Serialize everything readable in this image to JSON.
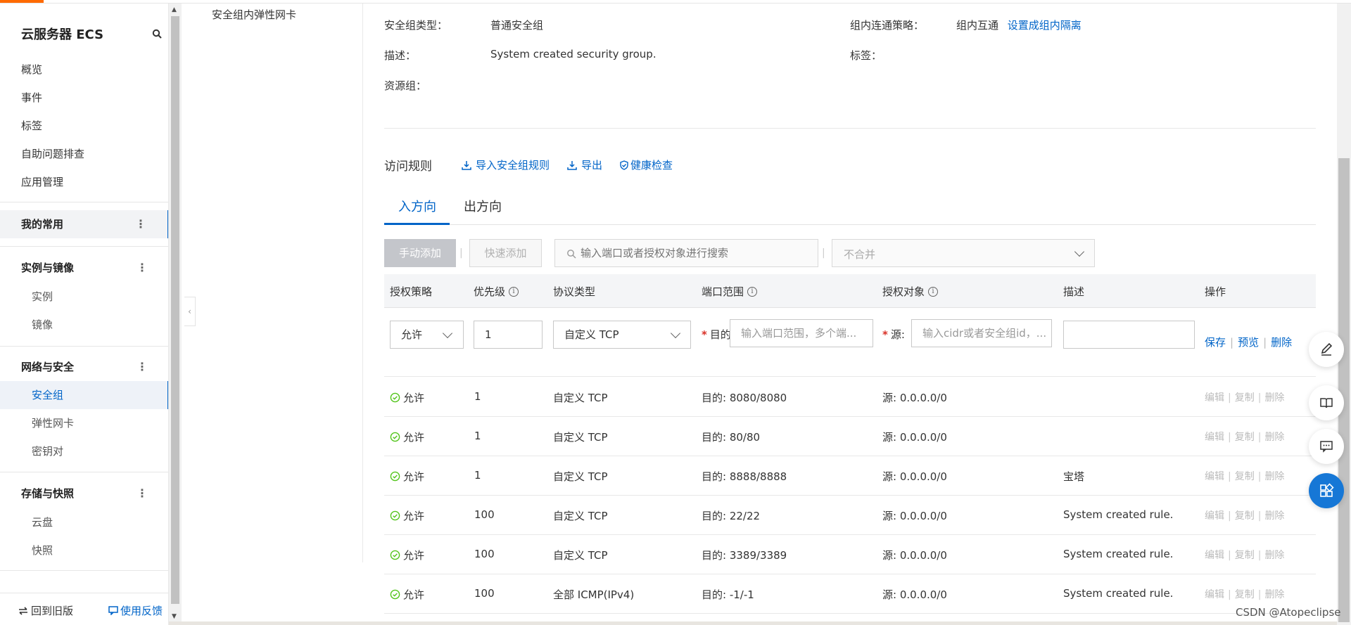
{
  "sidebar": {
    "title": "云服务器 ECS",
    "items": [
      "概览",
      "事件",
      "标签",
      "自助问题排查",
      "应用管理"
    ],
    "favorites": "我的常用",
    "groups": [
      {
        "label": "实例与镜像",
        "children": [
          "实例",
          "镜像"
        ]
      },
      {
        "label": "网络与安全",
        "children": [
          "安全组",
          "弹性网卡",
          "密钥对"
        ]
      },
      {
        "label": "存储与快照",
        "children": [
          "云盘",
          "快照"
        ]
      }
    ],
    "back_old": "回到旧版",
    "feedback": "使用反馈",
    "dots": "⋮"
  },
  "secondary_nav": {
    "item": "安全组内弹性网卡"
  },
  "info": {
    "type_label": "安全组类型：",
    "type_value": "普通安全组",
    "policy_label": "组内连通策略：",
    "policy_value": "组内互通",
    "policy_link": "设置成组内隔离",
    "desc_label": "描述：",
    "desc_value": "System created security group.",
    "tag_label": "标签：",
    "rg_label": "资源组："
  },
  "rules": {
    "title": "访问规则",
    "import": "导入安全组规则",
    "export": "导出",
    "health": "健康检查"
  },
  "tabs": {
    "inbound": "入方向",
    "outbound": "出方向"
  },
  "toolbar": {
    "manual_add": "手动添加",
    "quick_add": "快速添加",
    "search_placeholder": "输入端口或者授权对象进行搜索",
    "merge_placeholder": "不合并",
    "sep": "|"
  },
  "table": {
    "headers": [
      "授权策略",
      "优先级",
      "协议类型",
      "端口范围",
      "授权对象",
      "描述",
      "操作"
    ],
    "edit_row": {
      "policy": "允许",
      "priority": "1",
      "protocol": "自定义 TCP",
      "dest_label": "目的",
      "port_placeholder": "输入端口范围，多个端...",
      "src_label": "源:",
      "cidr_placeholder": "输入cidr或者安全组id，...",
      "save": "保存",
      "preview": "预览",
      "delete": "删除"
    },
    "rows": [
      {
        "policy": "允许",
        "priority": "1",
        "protocol": "自定义 TCP",
        "port": "目的: 8080/8080",
        "source": "源: 0.0.0.0/0",
        "desc": ""
      },
      {
        "policy": "允许",
        "priority": "1",
        "protocol": "自定义 TCP",
        "port": "目的: 80/80",
        "source": "源: 0.0.0.0/0",
        "desc": ""
      },
      {
        "policy": "允许",
        "priority": "1",
        "protocol": "自定义 TCP",
        "port": "目的: 8888/8888",
        "source": "源: 0.0.0.0/0",
        "desc": "宝塔"
      },
      {
        "policy": "允许",
        "priority": "100",
        "protocol": "自定义 TCP",
        "port": "目的: 22/22",
        "source": "源: 0.0.0.0/0",
        "desc": "System created rule."
      },
      {
        "policy": "允许",
        "priority": "100",
        "protocol": "自定义 TCP",
        "port": "目的: 3389/3389",
        "source": "源: 0.0.0.0/0",
        "desc": "System created rule."
      },
      {
        "policy": "允许",
        "priority": "100",
        "protocol": "全部 ICMP(IPv4)",
        "port": "目的: -1/-1",
        "source": "源: 0.0.0.0/0",
        "desc": "System created rule."
      }
    ],
    "ops": {
      "edit": "编辑",
      "copy": "复制",
      "delete": "删除",
      "sep": "|"
    }
  },
  "watermark": "CSDN @Atopeclipse",
  "colors": {
    "brand": "#0064c8",
    "accent": "#ff6a00",
    "success": "#52c41a"
  }
}
